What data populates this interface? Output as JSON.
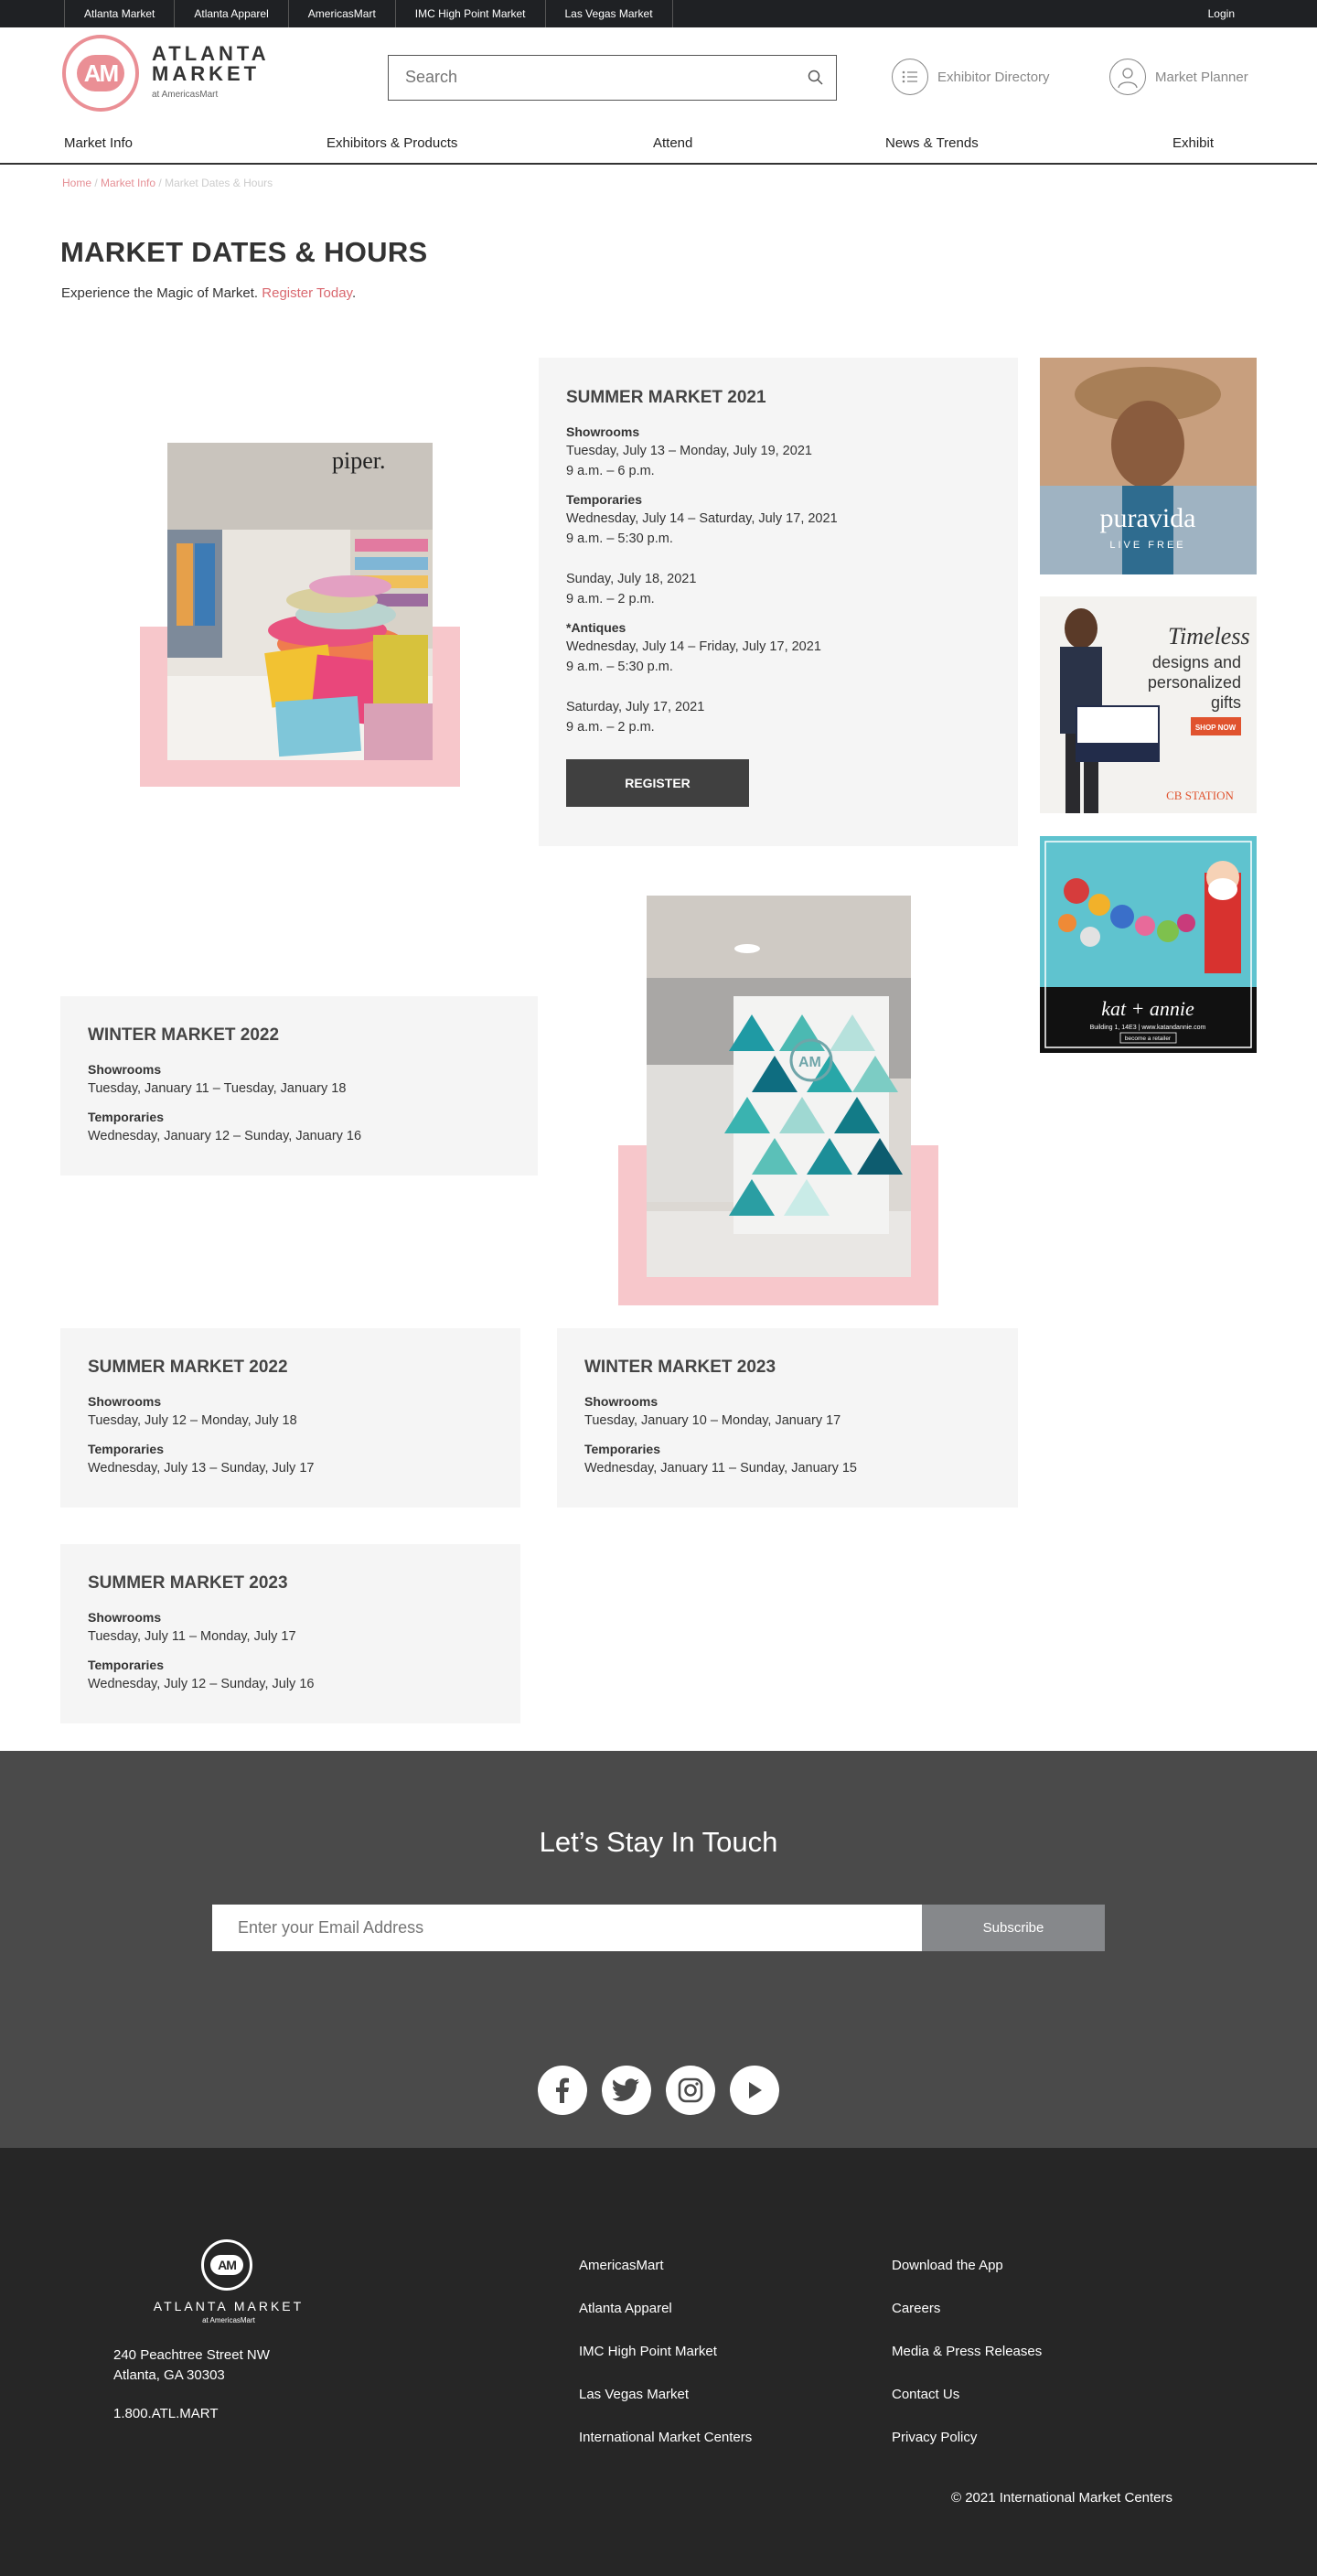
{
  "topbar": {
    "links": [
      "Atlanta Market",
      "Atlanta Apparel",
      "AmericasMart",
      "IMC High Point Market",
      "Las Vegas Market"
    ],
    "login": "Login"
  },
  "header": {
    "logo_mark": "AM",
    "logo_line1": "ATLANTA",
    "logo_line2": "MARKET",
    "logo_sub": "at AmericasMart",
    "search_placeholder": "Search",
    "exhibitor_directory": "Exhibitor Directory",
    "market_planner": "Market Planner"
  },
  "nav": [
    "Market Info",
    "Exhibitors & Products",
    "Attend",
    "News & Trends",
    "Exhibit"
  ],
  "breadcrumb": {
    "home": "Home",
    "sep": " / ",
    "market_info": "Market Info",
    "current": "Market Dates & Hours"
  },
  "page": {
    "title": "MARKET DATES & HOURS",
    "intro": "Experience the Magic of Market. ",
    "intro_link": "Register Today",
    "intro_end": "."
  },
  "summer2021": {
    "title": "SUMMER MARKET 2021",
    "showrooms_h": "Showrooms",
    "showrooms_dates": "Tuesday, July 13 – Monday, July 19, 2021",
    "showrooms_hours": "9 a.m. – 6 p.m.",
    "temp_h": "Temporaries",
    "temp_dates": "Wednesday, July 14 – Saturday, July 17, 2021",
    "temp_hours": "9 a.m. – 5:30 p.m.",
    "temp_sun_date": "Sunday, July 18, 2021",
    "temp_sun_hours": "9 a.m. – 2 p.m.",
    "antiques_h": "*Antiques",
    "antiques_dates": "Wednesday, July 14 – Friday, July 17, 2021",
    "antiques_hours": "9 a.m. – 5:30 p.m.",
    "antiques_sat_date": "Saturday, July 17, 2021",
    "antiques_sat_hours": "9 a.m. – 2 p.m.",
    "register": "REGISTER"
  },
  "winter2022": {
    "title": "WINTER MARKET 2022",
    "showrooms_h": "Showrooms",
    "showrooms_dates": "Tuesday, January 11 – Tuesday, January 18",
    "temp_h": "Temporaries",
    "temp_dates": "Wednesday, January 12 – Sunday, January 16"
  },
  "summer2022": {
    "title": "SUMMER MARKET 2022",
    "showrooms_h": "Showrooms",
    "showrooms_dates": "Tuesday, July 12 – Monday, July 18",
    "temp_h": "Temporaries",
    "temp_dates": "Wednesday, July 13 – Sunday, July 17"
  },
  "winter2023": {
    "title": "WINTER MARKET 2023",
    "showrooms_h": "Showrooms",
    "showrooms_dates": "Tuesday, January 10 – Monday, January 17",
    "temp_h": "Temporaries",
    "temp_dates": "Wednesday, January 11 – Sunday, January 15"
  },
  "summer2023": {
    "title": "SUMMER MARKET 2023",
    "showrooms_h": "Showrooms",
    "showrooms_dates": "Tuesday, July 11 – Monday, July 17",
    "temp_h": "Temporaries",
    "temp_dates": "Wednesday, July 12 – Sunday, July 16"
  },
  "images": {
    "piper_sign": "piper.",
    "atrium_mark": "AM"
  },
  "ads": {
    "puravida_brand": "puravida",
    "puravida_tag": "LIVE FREE",
    "cb_line1": "Timeless",
    "cb_line2": "designs and",
    "cb_line3": "personalized",
    "cb_line4": "gifts",
    "cb_shop": "SHOP NOW",
    "cb_brand": "CB STATION",
    "kat_brand": "kat + annie",
    "kat_line": "Building 1, 14E3  |  www.katandannie.com",
    "kat_cta": "become a retailer"
  },
  "newsletter": {
    "heading": "Let’s Stay In Touch",
    "placeholder": "Enter your Email Address",
    "subscribe": "Subscribe"
  },
  "footer": {
    "logo_mark": "AM",
    "brand": "ATLANTA MARKET",
    "brand_sub": "at AmericasMart",
    "address1": "240 Peachtree Street NW",
    "address2": "Atlanta, GA 30303",
    "phone": "1.800.ATL.MART",
    "col1": [
      "AmericasMart",
      "Atlanta Apparel",
      "IMC High Point Market",
      "Las Vegas Market",
      "International Market Centers"
    ],
    "col2": [
      "Download the App",
      "Careers",
      "Media & Press Releases",
      "Contact Us",
      "Privacy Policy"
    ],
    "copyright": "© 2021 International Market Centers"
  },
  "colors": {
    "accent_pink": "#e58f95",
    "dark_bar": "#1f2124",
    "card_bg": "#f5f5f5",
    "footer_bg": "#262626"
  }
}
